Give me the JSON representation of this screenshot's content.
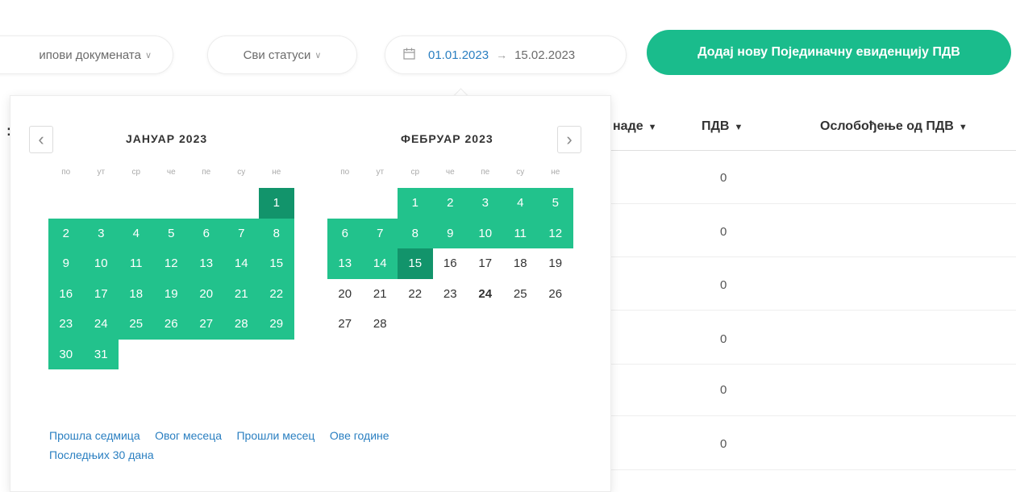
{
  "toolbar": {
    "doc_types_label": "ипови докумената",
    "statuses_label": "Сви статуси",
    "date_start": "01.01.2023",
    "date_end": "15.02.2023",
    "add_button_label": "Додај нову Појединачну евиденцију ПДВ"
  },
  "table": {
    "lead_glyph": ":",
    "columns": [
      "наде",
      "ПДВ",
      "Ослобођење од ПДВ"
    ],
    "vat_values": [
      "0",
      "0",
      "0",
      "0",
      "0",
      "0"
    ]
  },
  "calendar": {
    "weekdays": [
      "по",
      "ут",
      "ср",
      "че",
      "пе",
      "су",
      "не"
    ],
    "months": [
      {
        "title": "ЈАНУАР 2023",
        "lead_blanks": 6,
        "days": 31,
        "selected_from": 1,
        "selected_to": 31,
        "edge_days": [
          1
        ],
        "bold_days": []
      },
      {
        "title": "ФЕБРУАР 2023",
        "lead_blanks": 2,
        "days": 28,
        "selected_from": 1,
        "selected_to": 15,
        "edge_days": [
          15
        ],
        "bold_days": [
          24
        ]
      }
    ],
    "quick_links": [
      "Прошла седмица",
      "Овог месеца",
      "Прошли месец",
      "Ове године",
      "Последњих 30 дана"
    ]
  },
  "colors": {
    "accent": "#1abc8c",
    "range": "#22c28c",
    "range_edge": "#12946b",
    "link": "#2a7fc1"
  },
  "icons": {
    "calendar": "calendar-icon",
    "prev": "chevron-left-icon",
    "next": "chevron-right-icon",
    "arrow": "arrow-right-icon",
    "dropdown": "chevron-down-icon"
  }
}
